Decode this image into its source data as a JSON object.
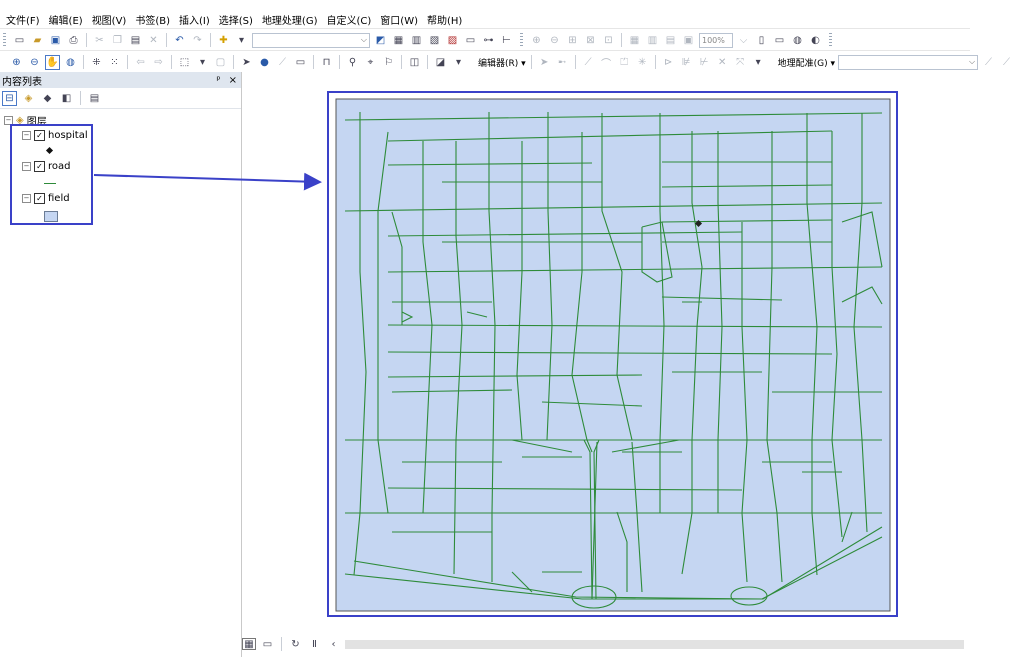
{
  "menu": [
    "文件(F)",
    "编辑(E)",
    "视图(V)",
    "书签(B)",
    "插入(I)",
    "选择(S)",
    "地理处理(G)",
    "自定义(C)",
    "窗口(W)",
    "帮助(H)"
  ],
  "toolbar": {
    "zoom_value": "100%",
    "editor_label": "编辑器(R) ▾",
    "georef_label": "地理配准(G) ▾"
  },
  "toc": {
    "title": "内容列表",
    "pin": "ᵖ",
    "close": "×",
    "root_label": "图层",
    "layers": [
      {
        "name": "hospital",
        "symbol": "point"
      },
      {
        "name": "road",
        "symbol": "line"
      },
      {
        "name": "field",
        "symbol": "polygon"
      }
    ]
  },
  "colors": {
    "annotation": "#3a41c8",
    "map_fill": "#c5d6f2",
    "road": "#2e8b3a",
    "hospital": "#222222"
  }
}
